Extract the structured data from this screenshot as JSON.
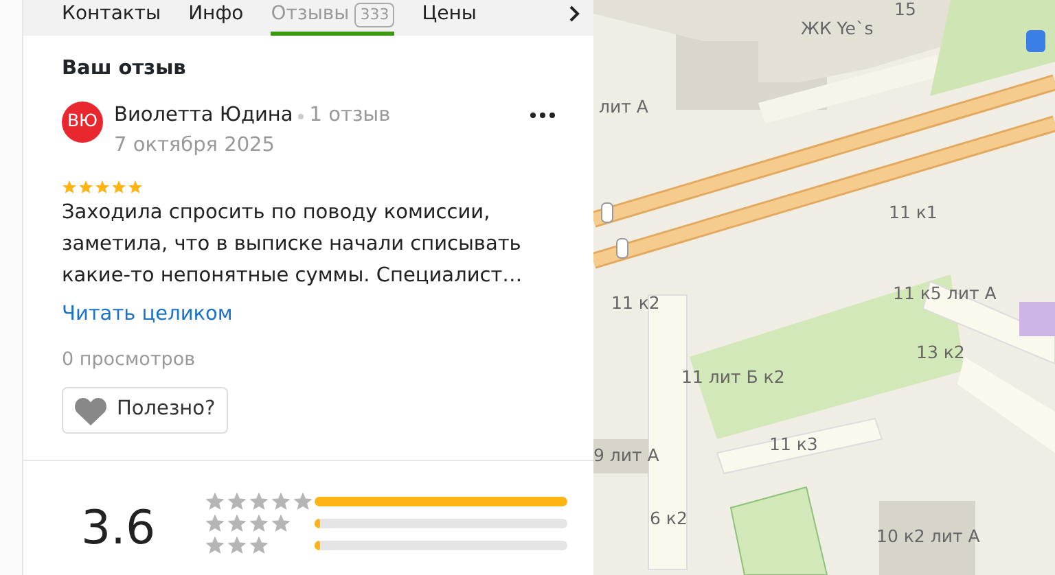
{
  "tabs": [
    {
      "label": "Контакты",
      "selected": false
    },
    {
      "label": "Инфо",
      "selected": false
    },
    {
      "label": "Отзывы",
      "count": "333",
      "selected": true
    },
    {
      "label": "Цены",
      "selected": false
    }
  ],
  "my_review": {
    "heading": "Ваш отзыв",
    "avatar_initials": "ВЮ",
    "author": "Виолетта Юдина",
    "author_reviews": "1 отзыв",
    "date": "7 октября 2025",
    "stars": 5,
    "text": "Заходила спросить по поводу комиссии, заметила, что в выписке начали списывать какие-то непонятные суммы. Специалист…",
    "read_more": "Читать целиком",
    "views": "0 просмотров",
    "helpful_button": "Полезно?"
  },
  "rating": {
    "score": "3.6",
    "distribution": [
      {
        "level": 1.0
      },
      {
        "level": 0.02
      },
      {
        "level": 0.02
      }
    ]
  },
  "map": {
    "labels": [
      "15",
      "ЖК Ye`s",
      "лит А",
      "11 к1",
      "11 к2",
      "11 к5 лит А",
      "13 к2",
      "11 лит Б к2",
      "11 к3",
      "9 лит А",
      "6 к2",
      "10 к2 лит А"
    ]
  }
}
